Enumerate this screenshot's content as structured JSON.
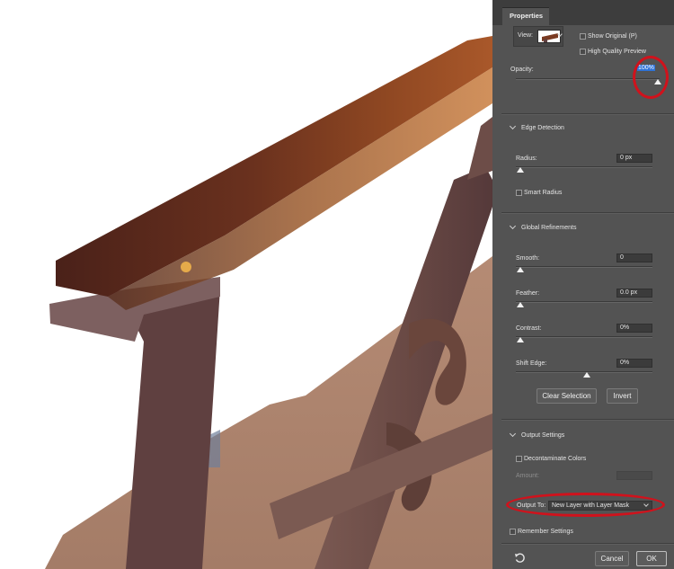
{
  "panel": {
    "title": "Properties",
    "view_label": "View:",
    "show_original_label": "Show Original (P)",
    "high_quality_preview_label": "High Quality Preview",
    "opacity_label": "Opacity:",
    "opacity_value": "100%",
    "opacity_level": 1.0
  },
  "edge_detection": {
    "title": "Edge Detection",
    "radius_label": "Radius:",
    "radius_value": "0 px",
    "smart_radius_label": "Smart Radius"
  },
  "global_refinements": {
    "title": "Global Refinements",
    "smooth_label": "Smooth:",
    "smooth_value": "0",
    "feather_label": "Feather:",
    "feather_value": "0.0 px",
    "contrast_label": "Contrast:",
    "contrast_value": "0%",
    "shift_edge_label": "Shift Edge:",
    "shift_edge_value": "0%",
    "clear_selection_label": "Clear Selection",
    "invert_label": "Invert"
  },
  "output_settings": {
    "title": "Output Settings",
    "decontaminate_label": "Decontaminate Colors",
    "amount_label": "Amount:",
    "output_to_label": "Output To:",
    "output_to_value": "New Layer with Layer Mask",
    "remember_settings_label": "Remember Settings"
  },
  "footer": {
    "cancel_label": "Cancel",
    "ok_label": "OK",
    "reset_icon": "reset-icon"
  },
  "colors": {
    "panel_bg": "#535353",
    "highlight_ring": "#d0121c",
    "selection_blue": "#2f73d6"
  }
}
